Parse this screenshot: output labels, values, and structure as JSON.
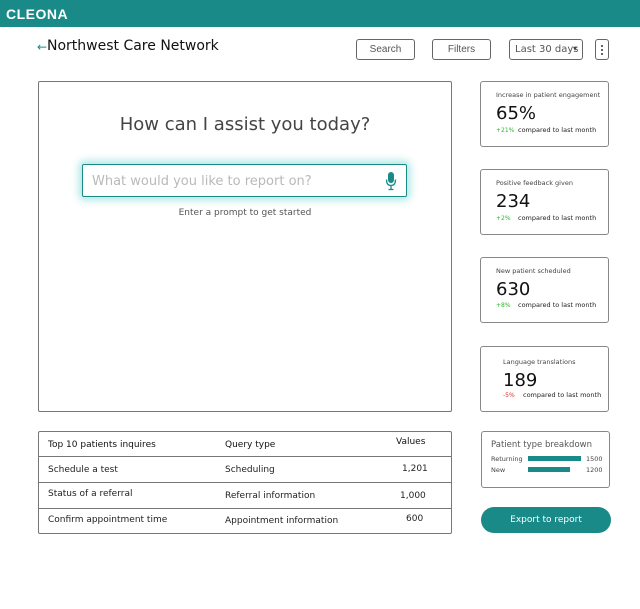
{
  "app": {
    "logo": "CLEONA",
    "brand_color": "#1a8a88"
  },
  "header": {
    "title": "Northwest Care Network",
    "search_label": "Search",
    "filters_label": "Filters",
    "date_range": "Last 30 days",
    "date_options": [
      "Last 30 days"
    ]
  },
  "assistant": {
    "heading": "How can I assist you today?",
    "placeholder": "What would you like to report on?",
    "hint": "Enter a prompt to get started"
  },
  "kpis": [
    {
      "label": "Increase in patient engagement",
      "value": "65%",
      "delta": "+21%",
      "delta_sign": "positive",
      "compare": "compared to last month"
    },
    {
      "label": "Positive feedback given",
      "value": "234",
      "delta": "+2%",
      "delta_sign": "positive",
      "compare": "compared to last month"
    },
    {
      "label": "New patient scheduled",
      "value": "630",
      "delta": "+8%",
      "delta_sign": "positive",
      "compare": "compared to last month"
    },
    {
      "label": "Language translations",
      "value": "189",
      "delta": "-5%",
      "delta_sign": "negative",
      "compare": "compared to last month"
    }
  ],
  "table": {
    "columns": [
      "Top 10 patients inquires",
      "Query type",
      "Values"
    ],
    "rows": [
      [
        "Schedule a test",
        "Scheduling",
        "1,201"
      ],
      [
        "Status of a referral",
        "Referral information",
        "1,000"
      ],
      [
        "Confirm appointment time",
        "Appointment information",
        "600"
      ]
    ]
  },
  "breakdown": {
    "title": "Patient type breakdown",
    "items": [
      {
        "label": "Returning",
        "value": 1500
      },
      {
        "label": "New",
        "value": 1200
      }
    ]
  },
  "export_label": "Export to report",
  "colors": {
    "positive": "#2fb52f",
    "negative": "#e03030"
  }
}
